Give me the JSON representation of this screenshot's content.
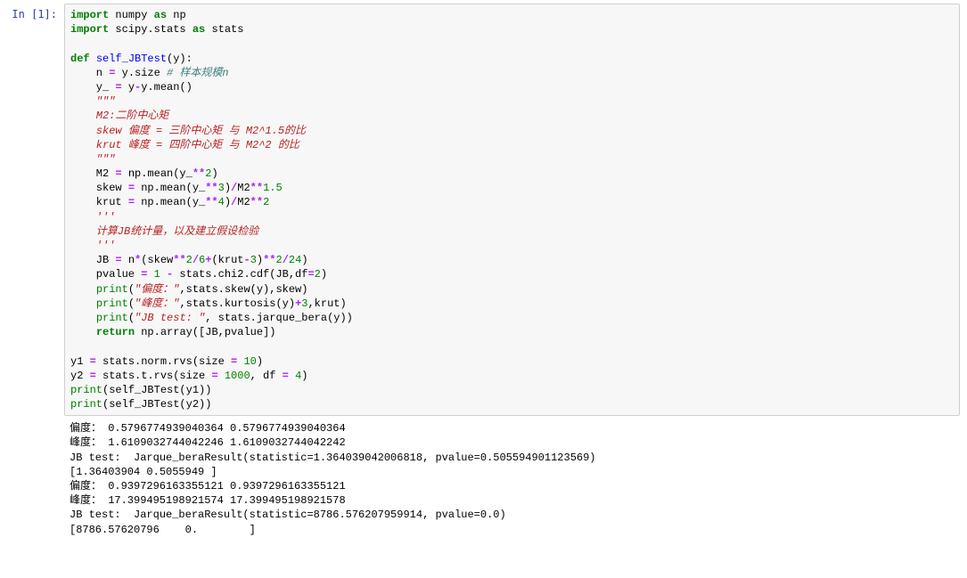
{
  "cell": {
    "prompt": "In [1]:",
    "code_lines": [
      [
        {
          "c": "kw",
          "t": "import"
        },
        {
          "c": "nn",
          "t": " numpy "
        },
        {
          "c": "kw",
          "t": "as"
        },
        {
          "c": "nn",
          "t": " np"
        }
      ],
      [
        {
          "c": "kw",
          "t": "import"
        },
        {
          "c": "nn",
          "t": " scipy.stats "
        },
        {
          "c": "kw",
          "t": "as"
        },
        {
          "c": "nn",
          "t": " stats"
        }
      ],
      [],
      [
        {
          "c": "kw",
          "t": "def"
        },
        {
          "c": "nn",
          "t": " "
        },
        {
          "c": "fn",
          "t": "self_JBTest"
        },
        {
          "c": "nn",
          "t": "(y):"
        }
      ],
      [
        {
          "c": "nn",
          "t": "    n "
        },
        {
          "c": "op",
          "t": "="
        },
        {
          "c": "nn",
          "t": " y.size "
        },
        {
          "c": "cmt",
          "t": "# 样本规模n"
        }
      ],
      [
        {
          "c": "nn",
          "t": "    y_ "
        },
        {
          "c": "op",
          "t": "="
        },
        {
          "c": "nn",
          "t": " y"
        },
        {
          "c": "op",
          "t": "-"
        },
        {
          "c": "nn",
          "t": "y.mean()"
        }
      ],
      [
        {
          "c": "nn",
          "t": "    "
        },
        {
          "c": "str",
          "t": "\"\"\""
        }
      ],
      [
        {
          "c": "str",
          "t": "    M2:二阶中心矩"
        }
      ],
      [
        {
          "c": "str",
          "t": "    skew 偏度 = 三阶中心矩 与 M2^1.5的比"
        }
      ],
      [
        {
          "c": "str",
          "t": "    krut 峰度 = 四阶中心矩 与 M2^2 的比"
        }
      ],
      [
        {
          "c": "nn",
          "t": "    "
        },
        {
          "c": "str",
          "t": "\"\"\""
        }
      ],
      [
        {
          "c": "nn",
          "t": "    M2 "
        },
        {
          "c": "op",
          "t": "="
        },
        {
          "c": "nn",
          "t": " np.mean(y_"
        },
        {
          "c": "op",
          "t": "**"
        },
        {
          "c": "num",
          "t": "2"
        },
        {
          "c": "nn",
          "t": ")"
        }
      ],
      [
        {
          "c": "nn",
          "t": "    skew "
        },
        {
          "c": "op",
          "t": "="
        },
        {
          "c": "nn",
          "t": " np.mean(y_"
        },
        {
          "c": "op",
          "t": "**"
        },
        {
          "c": "num",
          "t": "3"
        },
        {
          "c": "nn",
          "t": ")"
        },
        {
          "c": "op",
          "t": "/"
        },
        {
          "c": "nn",
          "t": "M2"
        },
        {
          "c": "op",
          "t": "**"
        },
        {
          "c": "num",
          "t": "1.5"
        }
      ],
      [
        {
          "c": "nn",
          "t": "    krut "
        },
        {
          "c": "op",
          "t": "="
        },
        {
          "c": "nn",
          "t": " np.mean(y_"
        },
        {
          "c": "op",
          "t": "**"
        },
        {
          "c": "num",
          "t": "4"
        },
        {
          "c": "nn",
          "t": ")"
        },
        {
          "c": "op",
          "t": "/"
        },
        {
          "c": "nn",
          "t": "M2"
        },
        {
          "c": "op",
          "t": "**"
        },
        {
          "c": "num",
          "t": "2"
        }
      ],
      [
        {
          "c": "nn",
          "t": "    "
        },
        {
          "c": "str",
          "t": "'''"
        }
      ],
      [
        {
          "c": "str",
          "t": "    计算JB统计量，以及建立假设检验"
        }
      ],
      [
        {
          "c": "nn",
          "t": "    "
        },
        {
          "c": "str",
          "t": "'''"
        }
      ],
      [
        {
          "c": "nn",
          "t": "    JB "
        },
        {
          "c": "op",
          "t": "="
        },
        {
          "c": "nn",
          "t": " n"
        },
        {
          "c": "op",
          "t": "*"
        },
        {
          "c": "nn",
          "t": "(skew"
        },
        {
          "c": "op",
          "t": "**"
        },
        {
          "c": "num",
          "t": "2"
        },
        {
          "c": "op",
          "t": "/"
        },
        {
          "c": "num",
          "t": "6"
        },
        {
          "c": "op",
          "t": "+"
        },
        {
          "c": "nn",
          "t": "(krut"
        },
        {
          "c": "op",
          "t": "-"
        },
        {
          "c": "num",
          "t": "3"
        },
        {
          "c": "nn",
          "t": ")"
        },
        {
          "c": "op",
          "t": "**"
        },
        {
          "c": "num",
          "t": "2"
        },
        {
          "c": "op",
          "t": "/"
        },
        {
          "c": "num",
          "t": "24"
        },
        {
          "c": "nn",
          "t": ")"
        }
      ],
      [
        {
          "c": "nn",
          "t": "    pvalue "
        },
        {
          "c": "op",
          "t": "="
        },
        {
          "c": "nn",
          "t": " "
        },
        {
          "c": "num",
          "t": "1"
        },
        {
          "c": "nn",
          "t": " "
        },
        {
          "c": "op",
          "t": "-"
        },
        {
          "c": "nn",
          "t": " stats.chi2.cdf(JB,df"
        },
        {
          "c": "op",
          "t": "="
        },
        {
          "c": "num",
          "t": "2"
        },
        {
          "c": "nn",
          "t": ")"
        }
      ],
      [
        {
          "c": "nn",
          "t": "    "
        },
        {
          "c": "bi",
          "t": "print"
        },
        {
          "c": "nn",
          "t": "("
        },
        {
          "c": "str",
          "t": "\"偏度：\""
        },
        {
          "c": "nn",
          "t": ",stats.skew(y),skew)"
        }
      ],
      [
        {
          "c": "nn",
          "t": "    "
        },
        {
          "c": "bi",
          "t": "print"
        },
        {
          "c": "nn",
          "t": "("
        },
        {
          "c": "str",
          "t": "\"峰度：\""
        },
        {
          "c": "nn",
          "t": ",stats.kurtosis(y)"
        },
        {
          "c": "op",
          "t": "+"
        },
        {
          "c": "num",
          "t": "3"
        },
        {
          "c": "nn",
          "t": ",krut)"
        }
      ],
      [
        {
          "c": "nn",
          "t": "    "
        },
        {
          "c": "bi",
          "t": "print"
        },
        {
          "c": "nn",
          "t": "("
        },
        {
          "c": "str",
          "t": "\"JB test: \""
        },
        {
          "c": "nn",
          "t": ", stats.jarque_bera(y))"
        }
      ],
      [
        {
          "c": "nn",
          "t": "    "
        },
        {
          "c": "kw",
          "t": "return"
        },
        {
          "c": "nn",
          "t": " np.array([JB,pvalue])"
        }
      ],
      [],
      [
        {
          "c": "nn",
          "t": "y1 "
        },
        {
          "c": "op",
          "t": "="
        },
        {
          "c": "nn",
          "t": " stats.norm.rvs(size "
        },
        {
          "c": "op",
          "t": "="
        },
        {
          "c": "nn",
          "t": " "
        },
        {
          "c": "num",
          "t": "10"
        },
        {
          "c": "nn",
          "t": ")"
        }
      ],
      [
        {
          "c": "nn",
          "t": "y2 "
        },
        {
          "c": "op",
          "t": "="
        },
        {
          "c": "nn",
          "t": " stats.t.rvs(size "
        },
        {
          "c": "op",
          "t": "="
        },
        {
          "c": "nn",
          "t": " "
        },
        {
          "c": "num",
          "t": "1000"
        },
        {
          "c": "nn",
          "t": ", df "
        },
        {
          "c": "op",
          "t": "="
        },
        {
          "c": "nn",
          "t": " "
        },
        {
          "c": "num",
          "t": "4"
        },
        {
          "c": "nn",
          "t": ")"
        }
      ],
      [
        {
          "c": "bi",
          "t": "print"
        },
        {
          "c": "nn",
          "t": "(self_JBTest(y1))"
        }
      ],
      [
        {
          "c": "bi",
          "t": "print"
        },
        {
          "c": "nn",
          "t": "(self_JBTest(y2))"
        }
      ]
    ],
    "output_lines": [
      "偏度： 0.5796774939040364 0.5796774939040364",
      "峰度： 1.6109032744042246 1.6109032744042242",
      "JB test:  Jarque_beraResult(statistic=1.364039042006818, pvalue=0.505594901123569)",
      "[1.36403904 0.5055949 ]",
      "偏度： 0.9397296163355121 0.9397296163355121",
      "峰度： 17.399495198921574 17.399495198921578",
      "JB test:  Jarque_beraResult(statistic=8786.576207959914, pvalue=0.0)",
      "[8786.57620796    0.        ]"
    ]
  }
}
